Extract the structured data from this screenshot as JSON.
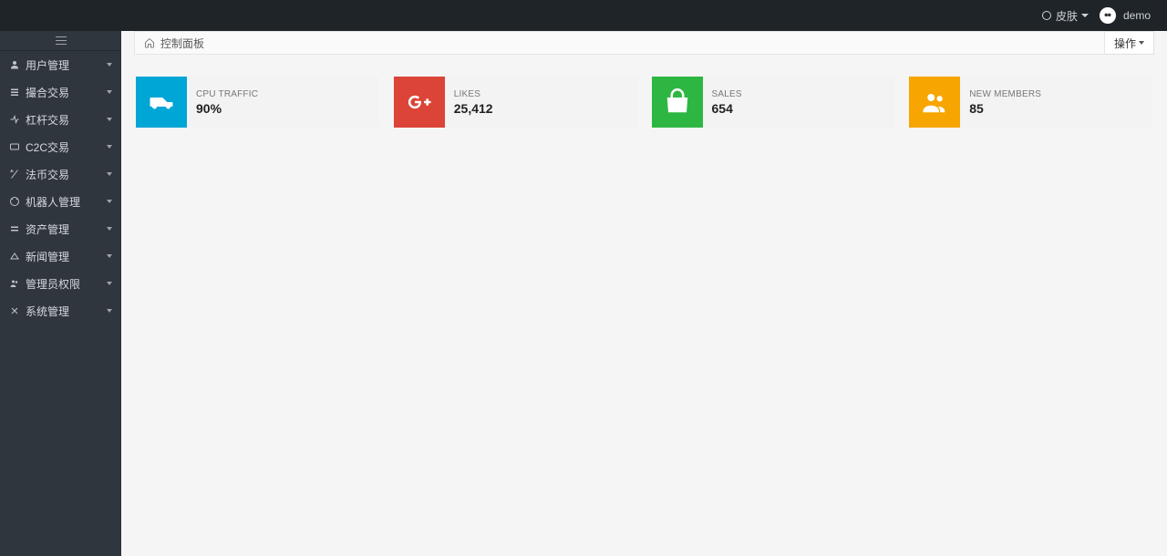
{
  "header": {
    "skin_label": "皮肤",
    "username": "demo"
  },
  "sidebar": {
    "items": [
      {
        "label": "用户管理",
        "icon": "user-icon"
      },
      {
        "label": "撮合交易",
        "icon": "exchange-icon"
      },
      {
        "label": "杠杆交易",
        "icon": "leverage-icon"
      },
      {
        "label": "C2C交易",
        "icon": "c2c-icon"
      },
      {
        "label": "法币交易",
        "icon": "fiat-icon"
      },
      {
        "label": "机器人管理",
        "icon": "robot-icon"
      },
      {
        "label": "资产管理",
        "icon": "asset-icon"
      },
      {
        "label": "新闻管理",
        "icon": "news-icon"
      },
      {
        "label": "管理员权限",
        "icon": "admin-icon"
      },
      {
        "label": "系统管理",
        "icon": "system-icon"
      }
    ]
  },
  "breadcrumb": {
    "title": "控制面板",
    "ops_label": "操作"
  },
  "cards": [
    {
      "label": "CPU TRAFFIC",
      "value": "90%",
      "icon": "ambulance-icon",
      "color": "#00a6d6"
    },
    {
      "label": "LIKES",
      "value": "25,412",
      "icon": "google-plus-icon",
      "color": "#db4437"
    },
    {
      "label": "SALES",
      "value": "654",
      "icon": "shopping-bag-icon",
      "color": "#2db742"
    },
    {
      "label": "NEW MEMBERS",
      "value": "85",
      "icon": "users-icon",
      "color": "#f7a500"
    }
  ]
}
